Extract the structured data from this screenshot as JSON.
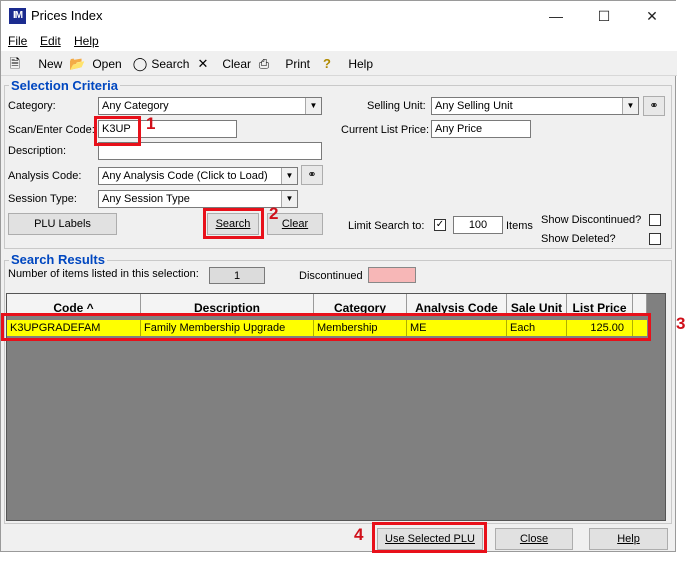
{
  "window": {
    "title": "Prices Index",
    "app_icon": "IM",
    "controls": [
      "minimize-icon",
      "maximize-icon",
      "close-icon"
    ]
  },
  "menu": [
    "File",
    "Edit",
    "Help"
  ],
  "toolbar": [
    {
      "label": "New",
      "icon": "new-file-icon"
    },
    {
      "label": "Open",
      "icon": "open-folder-icon"
    },
    {
      "label": "Search",
      "icon": "binoculars-icon"
    },
    {
      "label": "Clear",
      "icon": "clear-x-icon"
    },
    {
      "label": "Print",
      "icon": "printer-icon"
    },
    {
      "label": "Help",
      "icon": "help-question-icon"
    }
  ],
  "selection": {
    "title": "Selection Criteria",
    "category_label": "Category:",
    "category_value": "Any Category",
    "scan_label": "Scan/Enter Code:",
    "scan_value": "K3UP",
    "description_label": "Description:",
    "description_value": "",
    "analysis_label": "Analysis Code:",
    "analysis_value": "Any Analysis Code (Click to Load)",
    "session_label": "Session Type:",
    "session_value": "Any Session Type",
    "selling_unit_label": "Selling Unit:",
    "selling_unit_value": "Any Selling Unit",
    "list_price_label": "Current List Price:",
    "list_price_value": "Any Price",
    "plu_labels_button": "PLU Labels",
    "search_button": "Search",
    "clear_button": "Clear",
    "limit_label": "Limit Search to:",
    "limit_checked": true,
    "limit_value": "100",
    "items_label": "Items",
    "show_discontinued_label": "Show Discontinued?",
    "show_deleted_label": "Show Deleted?"
  },
  "results": {
    "title": "Search Results",
    "count_label": "Number of items listed in this selection:",
    "count_value": "1",
    "discontinued_label": "Discontinued",
    "discontinued_color": "#f7b7b7",
    "columns": [
      "Code ^",
      "Description",
      "Category",
      "Analysis Code",
      "Sale Unit",
      "List Price"
    ],
    "rows": [
      [
        "K3UPGRADEFAM",
        "Family Membership Upgrade",
        "Membership",
        "ME",
        "Each",
        "125.00"
      ]
    ],
    "selected_row_color": "#ffff00"
  },
  "footer": {
    "use_plu_button": "Use Selected PLU",
    "close_button": "Close",
    "help_button": "Help"
  },
  "annotations": [
    "1",
    "2",
    "3",
    "4"
  ],
  "colors": {
    "accent_title": "#0047c0",
    "annotation_red": "#e8101a"
  }
}
